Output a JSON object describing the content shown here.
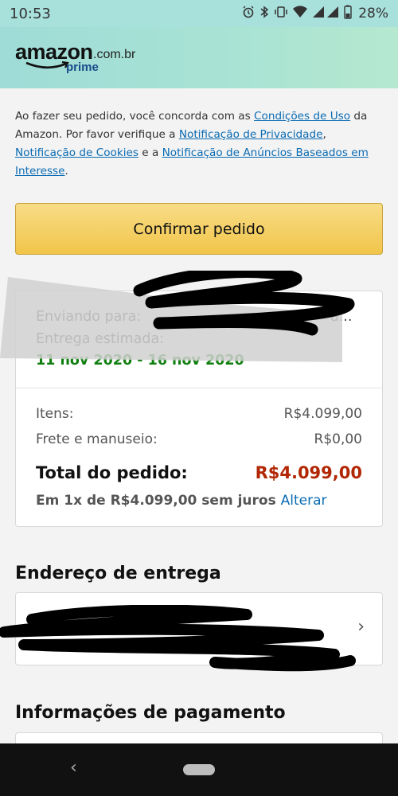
{
  "status_bar": {
    "time": "10:53",
    "battery": "28%",
    "icons": [
      "alarm-icon",
      "bluetooth-icon",
      "vibrate-icon",
      "wifi-icon",
      "signal-icon",
      "battery-icon"
    ]
  },
  "header": {
    "logo_word": "amazon",
    "logo_domain": ".com.br",
    "logo_prime": "prime"
  },
  "terms": {
    "t1": "Ao fazer seu pedido, você concorda com as ",
    "link_conditions": "Condições de Uso",
    "t2": " da Amazon. Por favor verifique a ",
    "link_privacy": "Notificação de Privacidade",
    "t3": ", ",
    "link_cookies": "Notificação de Cookies",
    "t4": " e a ",
    "link_ads": "Notificação de Anúncios Baseados em Interesse",
    "t5": "."
  },
  "confirm_button": "Confirmar pedido",
  "summary": {
    "shipping_to_label": "Enviando para:",
    "shipping_to_suffix": "a...",
    "estimated_label": "Entrega estimada:",
    "delivery_dates": "11 nov 2020 - 16 nov 2020",
    "items_label": "Itens:",
    "items_value": "R$4.099,00",
    "shipping_label": "Frete e manuseio:",
    "shipping_value": "R$0,00",
    "total_label": "Total do pedido:",
    "total_value": "R$4.099,00",
    "installment_text": "Em 1x de R$4.099,00 sem juros",
    "change_link": "Alterar"
  },
  "address_section": {
    "title": "Endereço de entrega",
    "chevron": "›"
  },
  "payment_section": {
    "title": "Informações de pagamento"
  },
  "nav": {
    "back": "‹"
  },
  "colors": {
    "header_bg": "#a8e0dc",
    "button_yellow": "#f1c54a",
    "delivery_green": "#0f7e0f",
    "total_red": "#b12704",
    "link_blue": "#0a6bb3"
  }
}
